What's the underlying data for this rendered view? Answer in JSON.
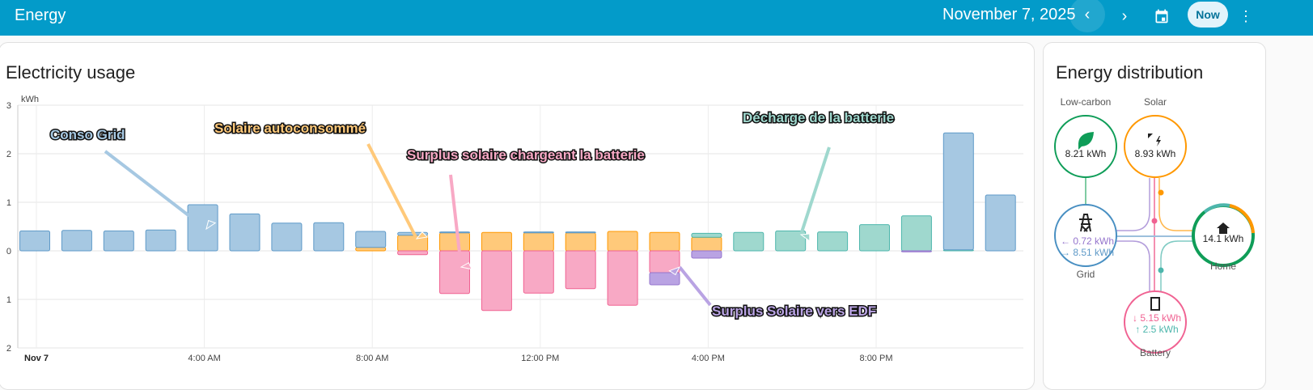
{
  "header": {
    "title": "Energy",
    "date": "November 7, 2025",
    "now_label": "Now",
    "prev_icon": "chevron-left-icon",
    "next_icon": "chevron-right-icon",
    "calendar_icon": "calendar-icon",
    "menu_icon": "dots-vertical-icon"
  },
  "usage_card": {
    "title": "Electricity usage"
  },
  "chart_data": {
    "type": "bar",
    "title": "Electricity usage",
    "ylabel": "kWh",
    "ylim": [
      -2,
      3
    ],
    "yticks": [
      {
        "v": 3,
        "l": "3"
      },
      {
        "v": 2,
        "l": "2"
      },
      {
        "v": 1,
        "l": "1"
      },
      {
        "v": 0,
        "l": "0"
      },
      {
        "v": -1,
        "l": "1"
      },
      {
        "v": -2,
        "l": "2"
      }
    ],
    "xticks": [
      {
        "hour": 0,
        "l": "Nov 7",
        "bold": true
      },
      {
        "hour": 4,
        "l": "4:00 AM"
      },
      {
        "hour": 8,
        "l": "8:00 AM"
      },
      {
        "hour": 12,
        "l": "12:00 PM"
      },
      {
        "hour": 16,
        "l": "4:00 PM"
      },
      {
        "hour": 20,
        "l": "8:00 PM"
      }
    ],
    "stack_order_positive": [
      "solar",
      "battery_out",
      "grid_in"
    ],
    "stack_order_negative": [
      "battery_in",
      "grid_out"
    ],
    "series": [
      {
        "name": "grid_in",
        "label": "Conso Grid",
        "fill": "#a6c8e2",
        "stroke": "#5f9ac8",
        "values": [
          0.41,
          0.42,
          0.41,
          0.43,
          0.95,
          0.76,
          0.57,
          0.58,
          0.33,
          0.06,
          0.02,
          0,
          0.02,
          0.02,
          0,
          0,
          0,
          0,
          0,
          0,
          0,
          0,
          2.41,
          1.15
        ]
      },
      {
        "name": "solar",
        "label": "Solaire autoconsommé",
        "fill": "#ffc97a",
        "stroke": "#ff9800",
        "values": [
          0,
          0,
          0,
          0,
          0,
          0,
          0,
          0,
          0.07,
          0.32,
          0.37,
          0.38,
          0.37,
          0.37,
          0.4,
          0.38,
          0.28,
          0,
          0,
          0,
          0,
          0,
          0,
          0
        ]
      },
      {
        "name": "battery_out",
        "label": "Décharge de la batterie",
        "fill": "#9fd8ce",
        "stroke": "#4db6ac",
        "values": [
          0,
          0,
          0,
          0,
          0,
          0,
          0,
          0,
          0,
          0,
          0,
          0,
          0,
          0,
          0,
          0,
          0.08,
          0.38,
          0.41,
          0.39,
          0.54,
          0.72,
          0.02,
          0
        ]
      },
      {
        "name": "battery_in",
        "label": "Surplus solaire chargeant la batterie",
        "fill": "#f8a9c5",
        "stroke": "#f06292",
        "values": [
          0,
          0,
          0,
          0,
          0,
          0,
          0,
          0,
          0,
          0.08,
          0.88,
          1.23,
          0.87,
          0.78,
          1.12,
          0.45,
          0,
          0,
          0,
          0,
          0,
          0,
          0,
          0
        ]
      },
      {
        "name": "grid_out",
        "label": "Surplus Solaire vers EDF",
        "fill": "#b9a3e3",
        "stroke": "#9575cd",
        "values": [
          0,
          0,
          0,
          0,
          0,
          0,
          0,
          0,
          0,
          0,
          0,
          0,
          0,
          0,
          0,
          0.25,
          0.15,
          0,
          0,
          0,
          0,
          0.02,
          0,
          0
        ]
      }
    ],
    "annotations": [
      {
        "text": "Conso Grid",
        "color": "#a6c8e2"
      },
      {
        "text": "Solaire autoconsommé",
        "color": "#ffc97a"
      },
      {
        "text": "Surplus solaire chargeant la batterie",
        "color": "#f8a9c5"
      },
      {
        "text": "Décharge de la batterie",
        "color": "#9fd8ce"
      },
      {
        "text": "Surplus Solaire vers EDF",
        "color": "#b9a3e3"
      }
    ]
  },
  "distribution": {
    "title": "Energy distribution",
    "low_carbon": {
      "label": "Low-carbon",
      "value": "8.21 kWh",
      "color": "#0f9d58"
    },
    "solar": {
      "label": "Solar",
      "value": "8.93 kWh",
      "color": "#ff9800"
    },
    "grid": {
      "label": "Grid",
      "return": "← 0.72 kWh",
      "consumption": "→ 8.51 kWh",
      "color": "#488fc2"
    },
    "home": {
      "label": "Home",
      "value": "14.1 kWh"
    },
    "battery": {
      "label": "Battery",
      "in": "↓ 5.15 kWh",
      "out": "↑ 2.5 kWh",
      "color": "#f06292"
    }
  }
}
